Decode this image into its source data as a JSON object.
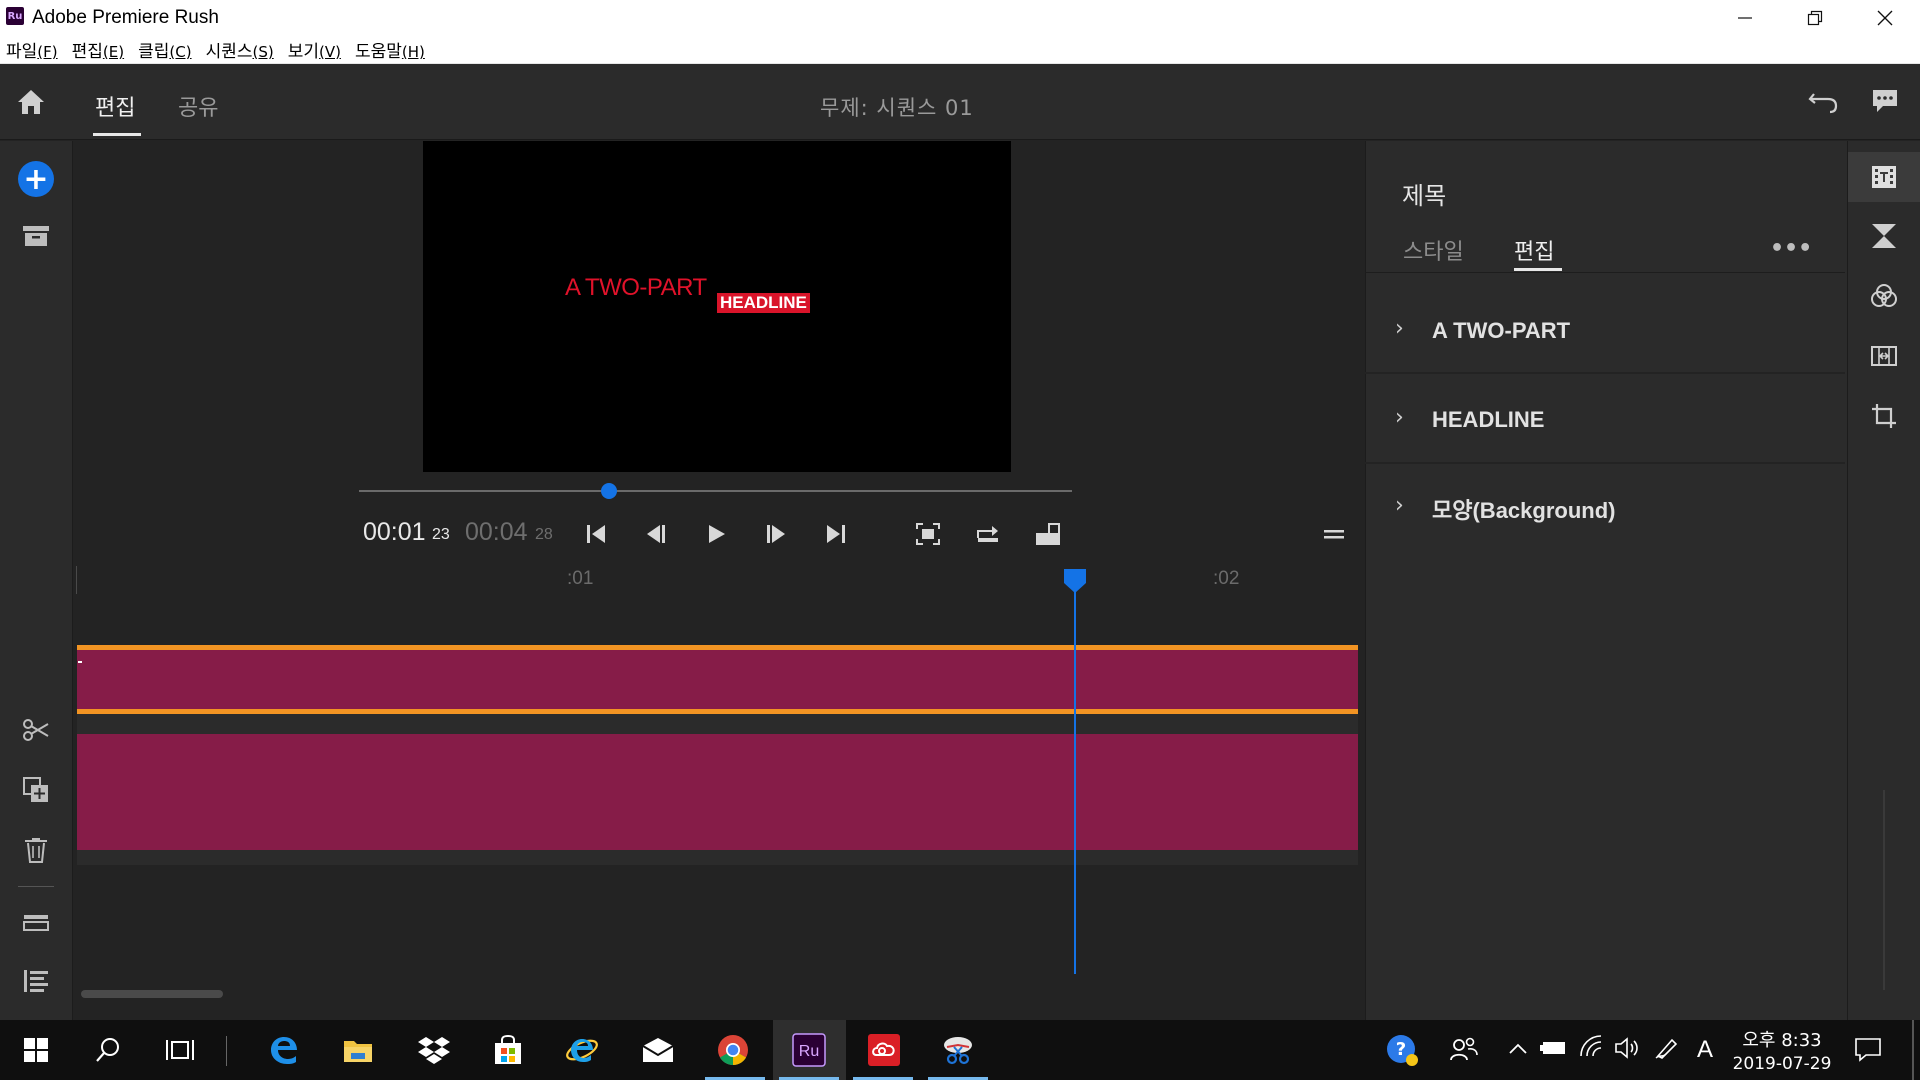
{
  "window": {
    "title": "Adobe Premiere Rush",
    "logo_text": "Ru"
  },
  "menubar": [
    {
      "label": "파일",
      "key": "(F)"
    },
    {
      "label": "편집",
      "key": "(E)"
    },
    {
      "label": "클립",
      "key": "(C)"
    },
    {
      "label": "시퀀스",
      "key": "(S)"
    },
    {
      "label": "보기",
      "key": "(V)"
    },
    {
      "label": "도움말",
      "key": "(H)"
    }
  ],
  "header": {
    "tabs": [
      {
        "label": "편집",
        "active": true
      },
      {
        "label": "공유",
        "active": false
      }
    ],
    "project_title": "무제: 시퀀스 01"
  },
  "preview": {
    "title_text_part1": "A TWO-PART",
    "title_text_part2": "HEADLINE",
    "playback_position": 0.35,
    "current_time": "00:01",
    "current_frames": "23",
    "duration": "00:04",
    "duration_frames": "28"
  },
  "timeline": {
    "ruler_labels": [
      ":01",
      ":02"
    ],
    "colors": {
      "clip": "#861c48",
      "selection": "#f29423",
      "playhead": "#1473e6"
    }
  },
  "panel": {
    "title": "제목",
    "tabs": [
      {
        "label": "스타일",
        "active": false
      },
      {
        "label": "편집",
        "active": true
      }
    ],
    "more_label": "•••",
    "sections": [
      "A TWO-PART",
      "HEADLINE",
      "모양(Background)"
    ]
  },
  "taskbar": {
    "clock_time": "오후 8:33",
    "clock_date": "2019-07-29",
    "ime": "A",
    "running_app_label": "Ru"
  },
  "colors": {
    "accent": "#1473e6",
    "title_red": "#e0122a"
  }
}
